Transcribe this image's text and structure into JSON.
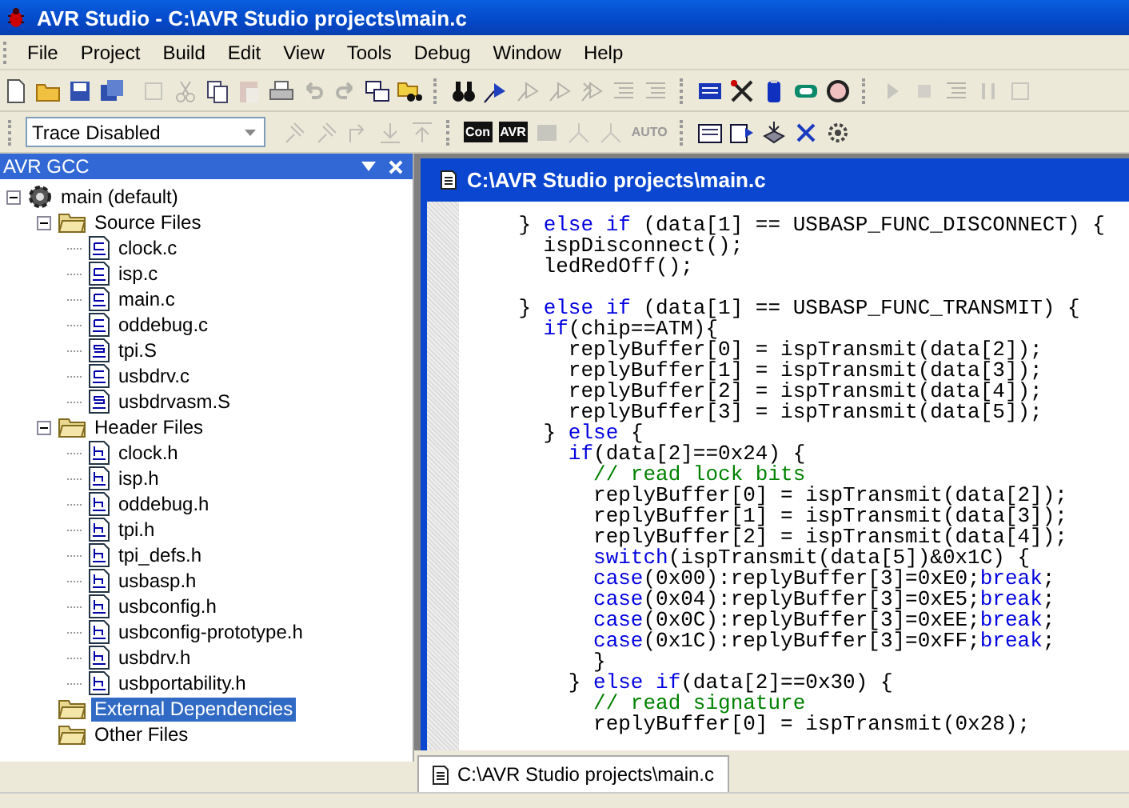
{
  "window": {
    "title": "AVR Studio - C:\\AVR Studio projects\\main.c"
  },
  "menu": [
    "File",
    "Project",
    "Build",
    "Edit",
    "View",
    "Tools",
    "Debug",
    "Window",
    "Help"
  ],
  "toolbar": {
    "trace_select": {
      "value": "Trace Disabled"
    },
    "labels": [
      {
        "text": "Con",
        "disabled": false
      },
      {
        "text": "AVR",
        "disabled": false
      },
      {
        "text": "AUTO",
        "disabled": true
      }
    ]
  },
  "project_panel": {
    "title": "AVR GCC",
    "tree": [
      {
        "label": "main (default)",
        "kind": "project",
        "expanded": true,
        "selected": false,
        "children": [
          {
            "label": "Source Files",
            "kind": "folder",
            "expanded": true,
            "selected": false,
            "children": [
              {
                "label": "clock.c",
                "kind": "c",
                "selected": false
              },
              {
                "label": "isp.c",
                "kind": "c",
                "selected": false
              },
              {
                "label": "main.c",
                "kind": "c",
                "selected": false
              },
              {
                "label": "oddebug.c",
                "kind": "c",
                "selected": false
              },
              {
                "label": "tpi.S",
                "kind": "s",
                "selected": false
              },
              {
                "label": "usbdrv.c",
                "kind": "c",
                "selected": false
              },
              {
                "label": "usbdrvasm.S",
                "kind": "s",
                "selected": false
              }
            ]
          },
          {
            "label": "Header Files",
            "kind": "folder",
            "expanded": true,
            "selected": false,
            "children": [
              {
                "label": "clock.h",
                "kind": "h",
                "selected": false
              },
              {
                "label": "isp.h",
                "kind": "h",
                "selected": false
              },
              {
                "label": "oddebug.h",
                "kind": "h",
                "selected": false
              },
              {
                "label": "tpi.h",
                "kind": "h",
                "selected": false
              },
              {
                "label": "tpi_defs.h",
                "kind": "h",
                "selected": false
              },
              {
                "label": "usbasp.h",
                "kind": "h",
                "selected": false
              },
              {
                "label": "usbconfig.h",
                "kind": "h",
                "selected": false
              },
              {
                "label": "usbconfig-prototype.h",
                "kind": "h",
                "selected": false
              },
              {
                "label": "usbdrv.h",
                "kind": "h",
                "selected": false
              },
              {
                "label": "usbportability.h",
                "kind": "h",
                "selected": false
              }
            ]
          },
          {
            "label": "External Dependencies",
            "kind": "folder",
            "selected": true
          },
          {
            "label": "Other Files",
            "kind": "folder",
            "selected": false
          }
        ]
      }
    ]
  },
  "editor": {
    "title": "C:\\AVR Studio projects\\main.c",
    "lines": [
      {
        "parts": [
          {
            "kind": "plain",
            "text": "    } "
          },
          {
            "kind": "keyword",
            "text": "else if"
          },
          {
            "kind": "plain",
            "text": " (data[1] == USBASP_FUNC_DISCONNECT) {"
          }
        ]
      },
      {
        "parts": [
          {
            "kind": "plain",
            "text": "      ispDisconnect();"
          }
        ]
      },
      {
        "parts": [
          {
            "kind": "plain",
            "text": "      ledRedOff();"
          }
        ]
      },
      {
        "space_before": true,
        "parts": [
          {
            "kind": "plain",
            "text": "    } "
          },
          {
            "kind": "keyword",
            "text": "else if"
          },
          {
            "kind": "plain",
            "text": " (data[1] == USBASP_FUNC_TRANSMIT) {"
          }
        ]
      },
      {
        "parts": [
          {
            "kind": "keyword",
            "text": "      if"
          },
          {
            "kind": "plain",
            "text": "(chip==ATM){"
          }
        ]
      },
      {
        "parts": [
          {
            "kind": "plain",
            "text": "        replyBuffer[0] = ispTransmit(data[2]);"
          }
        ]
      },
      {
        "parts": [
          {
            "kind": "plain",
            "text": "        replyBuffer[1] = ispTransmit(data[3]);"
          }
        ]
      },
      {
        "parts": [
          {
            "kind": "plain",
            "text": "        replyBuffer[2] = ispTransmit(data[4]);"
          }
        ]
      },
      {
        "parts": [
          {
            "kind": "plain",
            "text": "        replyBuffer[3] = ispTransmit(data[5]);"
          }
        ]
      },
      {
        "parts": [
          {
            "kind": "plain",
            "text": "      } "
          },
          {
            "kind": "keyword",
            "text": "else"
          },
          {
            "kind": "plain",
            "text": " {"
          }
        ]
      },
      {
        "parts": [
          {
            "kind": "keyword",
            "text": "        if"
          },
          {
            "kind": "plain",
            "text": "(data[2]==0x24) {"
          }
        ]
      },
      {
        "parts": [
          {
            "kind": "comment",
            "text": "          // read lock bits"
          }
        ]
      },
      {
        "parts": [
          {
            "kind": "plain",
            "text": "          replyBuffer[0] = ispTransmit(data[2]);"
          }
        ]
      },
      {
        "parts": [
          {
            "kind": "plain",
            "text": "          replyBuffer[1] = ispTransmit(data[3]);"
          }
        ]
      },
      {
        "parts": [
          {
            "kind": "plain",
            "text": "          replyBuffer[2] = ispTransmit(data[4]);"
          }
        ]
      },
      {
        "parts": [
          {
            "kind": "keyword",
            "text": "          switch"
          },
          {
            "kind": "plain",
            "text": "(ispTransmit(data[5])&0x1C) {"
          }
        ]
      },
      {
        "parts": [
          {
            "kind": "keyword",
            "text": "          case"
          },
          {
            "kind": "plain",
            "text": "(0x00):replyBuffer[3]=0xE0;"
          },
          {
            "kind": "keyword",
            "text": "break"
          },
          {
            "kind": "plain",
            "text": ";"
          }
        ]
      },
      {
        "parts": [
          {
            "kind": "keyword",
            "text": "          case"
          },
          {
            "kind": "plain",
            "text": "(0x04):replyBuffer[3]=0xE5;"
          },
          {
            "kind": "keyword",
            "text": "break"
          },
          {
            "kind": "plain",
            "text": ";"
          }
        ]
      },
      {
        "parts": [
          {
            "kind": "keyword",
            "text": "          case"
          },
          {
            "kind": "plain",
            "text": "(0x0C):replyBuffer[3]=0xEE;"
          },
          {
            "kind": "keyword",
            "text": "break"
          },
          {
            "kind": "plain",
            "text": ";"
          }
        ]
      },
      {
        "parts": [
          {
            "kind": "keyword",
            "text": "          case"
          },
          {
            "kind": "plain",
            "text": "(0x1C):replyBuffer[3]=0xFF;"
          },
          {
            "kind": "keyword",
            "text": "break"
          },
          {
            "kind": "plain",
            "text": ";"
          }
        ]
      },
      {
        "parts": [
          {
            "kind": "plain",
            "text": "          }"
          }
        ]
      },
      {
        "parts": [
          {
            "kind": "plain",
            "text": "        } "
          },
          {
            "kind": "keyword",
            "text": "else if"
          },
          {
            "kind": "plain",
            "text": "(data[2]==0x30) {"
          }
        ]
      },
      {
        "parts": [
          {
            "kind": "comment",
            "text": "          // read signature"
          }
        ]
      },
      {
        "parts": [
          {
            "kind": "plain",
            "text": "          replyBuffer[0] = ispTransmit(0x28);"
          }
        ]
      }
    ]
  },
  "document_tabs": [
    {
      "label": "C:\\AVR Studio projects\\main.c",
      "selected": true
    }
  ]
}
